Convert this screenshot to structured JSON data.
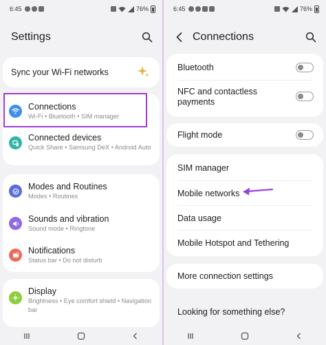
{
  "left": {
    "status": {
      "time": "6:45",
      "battery": "76%"
    },
    "header": {
      "title": "Settings"
    },
    "sync": {
      "label": "Sync your Wi-Fi networks"
    },
    "items": [
      {
        "label": "Connections",
        "sub": "Wi-Fi  •  Bluetooth  •  SIM manager"
      },
      {
        "label": "Connected devices",
        "sub": "Quick Share  •  Samsung DeX  •  Android Auto"
      },
      {
        "label": "Modes and Routines",
        "sub": "Modes  •  Routines"
      },
      {
        "label": "Sounds and vibration",
        "sub": "Sound mode  •  Ringtone"
      },
      {
        "label": "Notifications",
        "sub": "Status bar  •  Do not disturb"
      },
      {
        "label": "Display",
        "sub": "Brightness  •  Eye comfort shield  •  Navigation bar"
      }
    ],
    "icon_colors": {
      "connections": "#3d8ef0",
      "connected_devices": "#2fb6a4",
      "modes": "#5a6be0",
      "sounds": "#8b6be8",
      "notifications": "#ef6a5a",
      "display": "#8ccf3a"
    }
  },
  "right": {
    "status": {
      "time": "6:45",
      "battery": "76%"
    },
    "header": {
      "title": "Connections"
    },
    "items": {
      "bluetooth": "Bluetooth",
      "nfc": "NFC and contactless payments",
      "flight": "Flight mode",
      "sim": "SIM manager",
      "mobile": "Mobile networks",
      "data": "Data usage",
      "hotspot": "Mobile Hotspot and Tethering",
      "more": "More connection settings",
      "looking": "Looking for something else?"
    },
    "toggles": {
      "bluetooth": false,
      "nfc": false,
      "flight": false
    }
  },
  "colors": {
    "highlight": "#a03bd8",
    "arrow": "#9b3fe0"
  }
}
